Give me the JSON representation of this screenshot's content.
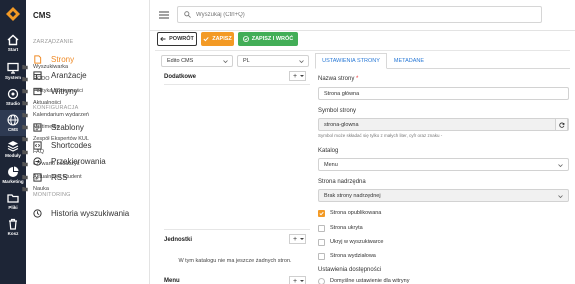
{
  "rail": {
    "items": [
      {
        "label": "Start",
        "icon": "home-icon"
      },
      {
        "label": "System",
        "icon": "monitor-icon"
      },
      {
        "label": "Studio",
        "icon": "studio-icon"
      },
      {
        "label": "CMS",
        "icon": "globe-icon"
      },
      {
        "label": "Moduły",
        "icon": "layers-icon"
      },
      {
        "label": "Marketing",
        "icon": "pie-chart-icon"
      },
      {
        "label": "Pliki",
        "icon": "folder-icon"
      },
      {
        "label": "Kosz",
        "icon": "trash-icon"
      }
    ]
  },
  "sidebar": {
    "title": "CMS",
    "sections": {
      "management": "ZARZĄDZANIE",
      "configuration": "KONFIGURACJA",
      "monitoring": "MONITORING"
    },
    "items": [
      {
        "label": "Strony",
        "icon": "pages-icon"
      },
      {
        "label": "Aranżacje",
        "icon": "layout-icon"
      },
      {
        "label": "Witryny",
        "icon": "sites-icon"
      },
      {
        "label": "Szablony",
        "icon": "template-icon"
      },
      {
        "label": "Shortcodes",
        "icon": "code-icon"
      },
      {
        "label": "Przekierowania",
        "icon": "redirect-icon"
      },
      {
        "label": "RSS",
        "icon": "rss-icon"
      },
      {
        "label": "Historia wyszukiwania",
        "icon": "history-icon"
      }
    ]
  },
  "search": {
    "placeholder": "Wyszukaj (Ctrl+Q)"
  },
  "toolbar": {
    "back": "POWRÓT",
    "save": "ZAPISZ",
    "save_back": "ZAPISZ I WRÓĆ"
  },
  "left": {
    "site_select": "Edito CMS",
    "lang_select": "PL",
    "dodatkowe_title": "Dodatkowe",
    "tree": [
      "Wyszukiwarka",
      "RODO",
      "Polityka dostępności",
      "Aktualności",
      "Kalendarium wydarzeń",
      "Multimedia",
      "Zespół Ekspertów KUL",
      "FAQ",
      "Co warto zobaczyć",
      "Aktualności Student",
      "Nauka"
    ],
    "jednostki_title": "Jednostki",
    "empty_msg": "W tym katalogu nie ma jeszcze żadnych stron.",
    "menu_title": "Menu",
    "plus": "+"
  },
  "form": {
    "tabs": [
      "USTAWIENIA STRONY",
      "METADANE"
    ],
    "name_label": "Nazwa strony",
    "name_value": "Strona główna",
    "symbol_label": "Symbol strony",
    "symbol_value": "strona-glowna",
    "symbol_hint": "Symbol może składać się tylko z małych liter, cyfr oraz znaku -",
    "catalog_label": "Katalog",
    "catalog_value": "Menu",
    "parent_label": "Strona nadrzędna",
    "parent_value": "Brak strony nadrzędnej",
    "checks": [
      {
        "label": "Strona opublikowana",
        "checked": true
      },
      {
        "label": "Strona ukryta",
        "checked": false
      },
      {
        "label": "Ukryj w wyszukiwarce",
        "checked": false
      },
      {
        "label": "Strona wydziałowa",
        "checked": false
      }
    ],
    "access_label": "Ustawienia dostępności",
    "access_default": "Domyślne ustawienie dla witryny"
  },
  "colors": {
    "accent": "#ef8a25",
    "save": "#f39a25",
    "save_back": "#43ae57",
    "rail": "#1d2536",
    "link": "#2979d6"
  }
}
